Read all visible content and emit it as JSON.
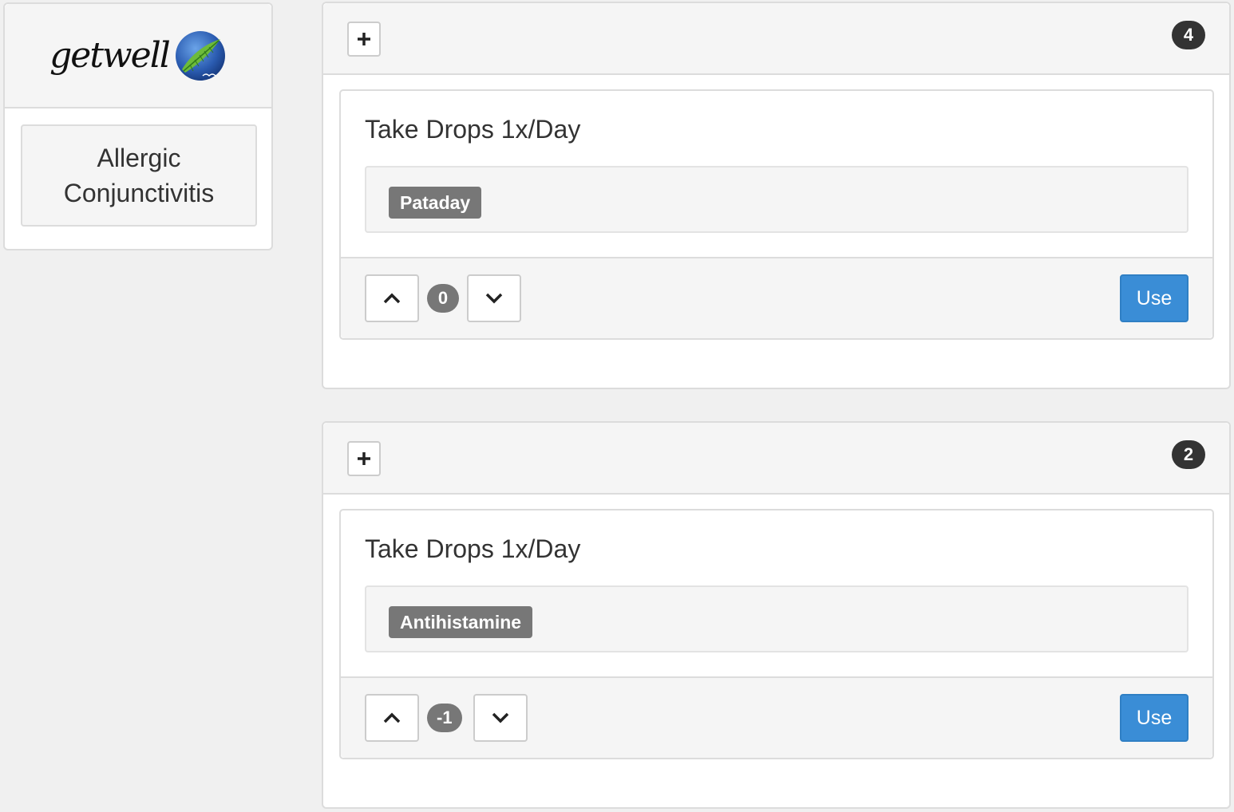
{
  "sidebar": {
    "logo_text": "getwell",
    "condition": "Allergic Conjunctivitis"
  },
  "panels": [
    {
      "count": "4",
      "card": {
        "title": "Take Drops 1x/Day",
        "tag": "Pataday",
        "score": "0",
        "use_label": "Use"
      }
    },
    {
      "count": "2",
      "card": {
        "title": "Take Drops 1x/Day",
        "tag": "Antihistamine",
        "score": "-1",
        "use_label": "Use"
      }
    }
  ],
  "icons": {
    "add": "plus-icon",
    "up": "chevron-up-icon",
    "down": "chevron-down-icon",
    "logo": "leaf-globe-icon"
  },
  "colors": {
    "primary": "#3a8dd6",
    "tag": "#777777",
    "badge": "#333333"
  }
}
